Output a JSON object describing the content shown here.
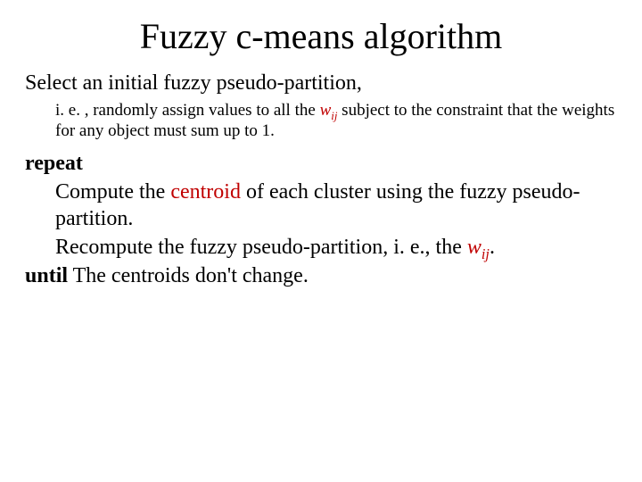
{
  "title": "Fuzzy c-means algorithm",
  "line1": "Select an initial fuzzy pseudo-partition,",
  "sub1_a": "i. e. , randomly assign values to all the ",
  "var_w": "w",
  "var_ij": "ij",
  "sub1_b": " subject to the constraint that the weights for any object must sum up to 1.",
  "kw_repeat": "repeat",
  "step1_a": "Compute the ",
  "term_centroid": "centroid",
  "step1_b": " of each cluster using the fuzzy pseudo-partition.",
  "step2_a": "Recompute the fuzzy pseudo-partition, i. e., the ",
  "step2_b": ".",
  "kw_until": "until",
  "until_rest": " The centroids don't change."
}
